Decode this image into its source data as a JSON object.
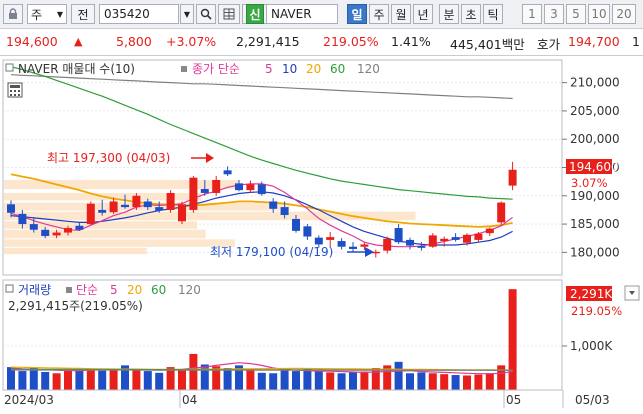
{
  "toolbar": {
    "lock_icon": "lock-icon",
    "period_label": "주",
    "jeon_label": "전",
    "code_value": "035420",
    "search_icon": "search-icon",
    "grid_icon": "grid-icon",
    "sound_icon": "speaker-icon",
    "new_badge": "신",
    "stock_name": "NAVER",
    "period_tabs": [
      "일",
      "주",
      "월",
      "년",
      "분",
      "초",
      "틱"
    ],
    "selected_period": "일",
    "interval_buttons": [
      "1",
      "3",
      "5",
      "10",
      "20"
    ]
  },
  "quote": {
    "price": "194,600",
    "change_arrow": "▲",
    "change": "5,800",
    "change_pct": "+3.07%",
    "volume": "2,291,415",
    "volume_ratio": "219.05%",
    "turnover": "1.41%",
    "amount": "445,401백만",
    "ask_label": "호가",
    "ask_price": "194,700",
    "tail": "1"
  },
  "price_panel": {
    "title": "NAVER 매물대 수(10)",
    "ma_label": "종가 단순",
    "ma_periods": [
      "5",
      "10",
      "20",
      "60",
      "120"
    ],
    "max_annotation": "최고 197,300 (04/03)",
    "min_annotation": "최저 179,100 (04/19)",
    "current_price_tag": "194,600",
    "current_pct_tag": "3.07%",
    "y_ticks": [
      "210,000",
      "205,000",
      "200,000",
      "195,000",
      "190,000",
      "185,000",
      "180,000"
    ]
  },
  "volume_panel": {
    "title": "거래량",
    "ma_label": "단순",
    "ma_periods": [
      "5",
      "20",
      "60",
      "120"
    ],
    "info": "2,291,415주(219.05%)",
    "current_tag": "2,291K",
    "current_pct_tag": "219.05%",
    "y_ticks": [
      "1,000K"
    ]
  },
  "x_axis": [
    "2024/03",
    "04",
    "05",
    "05/03"
  ],
  "colors": {
    "up": "#e8201c",
    "down": "#1f4fc7",
    "ma5": "#e0389a",
    "ma10": "#1f3fbf",
    "ma20": "#f0a800",
    "ma60": "#2e9e3c",
    "ma120": "#808080"
  },
  "chart_data": [
    {
      "type": "candlestick",
      "title": "NAVER 매물대 수(10)",
      "ylim": [
        176000,
        214000
      ],
      "volume_profile_bins": 10,
      "candles": [
        {
          "o": 188500,
          "h": 189200,
          "l": 186200,
          "c": 187000
        },
        {
          "o": 186800,
          "h": 187500,
          "l": 184200,
          "c": 185000
        },
        {
          "o": 185000,
          "h": 186000,
          "l": 183500,
          "c": 184000
        },
        {
          "o": 184000,
          "h": 184500,
          "l": 182500,
          "c": 182900
        },
        {
          "o": 183000,
          "h": 184000,
          "l": 182500,
          "c": 183500
        },
        {
          "o": 183500,
          "h": 184700,
          "l": 183000,
          "c": 184300
        },
        {
          "o": 184700,
          "h": 185200,
          "l": 183800,
          "c": 184000
        },
        {
          "o": 185000,
          "h": 189000,
          "l": 184800,
          "c": 188600
        },
        {
          "o": 187500,
          "h": 189300,
          "l": 186500,
          "c": 187000
        },
        {
          "o": 187100,
          "h": 189700,
          "l": 186800,
          "c": 189000
        },
        {
          "o": 188400,
          "h": 190200,
          "l": 187700,
          "c": 188000
        },
        {
          "o": 188000,
          "h": 190500,
          "l": 187500,
          "c": 190000
        },
        {
          "o": 189000,
          "h": 189500,
          "l": 187500,
          "c": 188000
        },
        {
          "o": 188000,
          "h": 189000,
          "l": 187000,
          "c": 187400
        },
        {
          "o": 187500,
          "h": 191000,
          "l": 187000,
          "c": 190500
        },
        {
          "o": 185500,
          "h": 189000,
          "l": 185000,
          "c": 188500
        },
        {
          "o": 187500,
          "h": 193500,
          "l": 187000,
          "c": 193200
        },
        {
          "o": 191200,
          "h": 192800,
          "l": 190000,
          "c": 190500
        },
        {
          "o": 190500,
          "h": 193500,
          "l": 190000,
          "c": 192800
        },
        {
          "o": 194500,
          "h": 195200,
          "l": 193500,
          "c": 193800
        },
        {
          "o": 192200,
          "h": 192800,
          "l": 190800,
          "c": 191000
        },
        {
          "o": 191000,
          "h": 192700,
          "l": 190500,
          "c": 192000
        },
        {
          "o": 192000,
          "h": 192500,
          "l": 190000,
          "c": 190300
        },
        {
          "o": 189000,
          "h": 189600,
          "l": 187000,
          "c": 187700
        },
        {
          "o": 188000,
          "h": 189000,
          "l": 186000,
          "c": 186600
        },
        {
          "o": 185900,
          "h": 186600,
          "l": 183500,
          "c": 183800
        },
        {
          "o": 184600,
          "h": 185000,
          "l": 182200,
          "c": 182800
        },
        {
          "o": 182600,
          "h": 183000,
          "l": 180800,
          "c": 181400
        },
        {
          "o": 182200,
          "h": 183600,
          "l": 181000,
          "c": 182700
        },
        {
          "o": 182000,
          "h": 182500,
          "l": 180500,
          "c": 181000
        },
        {
          "o": 181000,
          "h": 181800,
          "l": 180000,
          "c": 180600
        },
        {
          "o": 181000,
          "h": 181700,
          "l": 180400,
          "c": 181400
        },
        {
          "o": 179900,
          "h": 180500,
          "l": 179100,
          "c": 180100
        },
        {
          "o": 180300,
          "h": 182800,
          "l": 179800,
          "c": 182400
        },
        {
          "o": 184300,
          "h": 185000,
          "l": 181500,
          "c": 181800
        },
        {
          "o": 182200,
          "h": 182600,
          "l": 180500,
          "c": 181200
        },
        {
          "o": 181100,
          "h": 181800,
          "l": 180300,
          "c": 180800
        },
        {
          "o": 181000,
          "h": 183400,
          "l": 180800,
          "c": 183000
        },
        {
          "o": 182000,
          "h": 182800,
          "l": 181000,
          "c": 182400
        },
        {
          "o": 182700,
          "h": 183400,
          "l": 181900,
          "c": 182200
        },
        {
          "o": 181700,
          "h": 183400,
          "l": 181200,
          "c": 183100
        },
        {
          "o": 182200,
          "h": 183600,
          "l": 181800,
          "c": 183300
        },
        {
          "o": 183400,
          "h": 184400,
          "l": 182900,
          "c": 184200
        },
        {
          "o": 185300,
          "h": 189000,
          "l": 184900,
          "c": 188800
        },
        {
          "o": 191800,
          "h": 196000,
          "l": 191000,
          "c": 194600
        }
      ],
      "ma5": [
        186900,
        186300,
        185600,
        185000,
        184500,
        184000,
        183900,
        184800,
        185600,
        186500,
        187100,
        188000,
        188400,
        188300,
        188400,
        188600,
        189500,
        190300,
        190800,
        191500,
        191900,
        192100,
        192100,
        191700,
        190600,
        189200,
        187700,
        186000,
        184800,
        183800,
        182900,
        181800,
        181300,
        181100,
        181000,
        181000,
        181100,
        181500,
        181900,
        182400,
        182800,
        183300,
        183900,
        184700,
        186200
      ],
      "ma10": [
        186500,
        186300,
        186100,
        185900,
        185700,
        185500,
        185300,
        185300,
        185500,
        185800,
        186100,
        186500,
        187000,
        187400,
        187700,
        188000,
        188500,
        189000,
        189600,
        190000,
        190400,
        190600,
        190700,
        190500,
        190000,
        189300,
        188400,
        187500,
        186500,
        185500,
        184500,
        183700,
        183100,
        182500,
        182000,
        181700,
        181400,
        181300,
        181300,
        181300,
        181500,
        181800,
        182100,
        182700,
        183700
      ],
      "ma20": [
        193800,
        193400,
        193000,
        192500,
        192000,
        191500,
        191000,
        190400,
        189900,
        189500,
        189200,
        188900,
        188700,
        188500,
        188400,
        188300,
        188300,
        188400,
        188600,
        188800,
        189000,
        189000,
        188900,
        188800,
        188600,
        188300,
        188000,
        187600,
        187200,
        186800,
        186400,
        186100,
        185800,
        185500,
        185300,
        185100,
        185000,
        184900,
        184800,
        184700,
        184600,
        184500,
        184600,
        184800,
        185200
      ],
      "ma60": [
        212800,
        212300,
        211700,
        211100,
        210400,
        209700,
        209000,
        208300,
        207600,
        206800,
        206000,
        205200,
        204400,
        203500,
        202600,
        201800,
        201000,
        200200,
        199400,
        198600,
        197800,
        197000,
        196300,
        195700,
        195100,
        194500,
        194000,
        193500,
        193000,
        192600,
        192300,
        192000,
        191700,
        191400,
        191100,
        190900,
        190700,
        190500,
        190300,
        190100,
        189900,
        189800,
        189600,
        189500,
        189400
      ],
      "ma120": [
        211400,
        211300,
        211200,
        211100,
        211000,
        210900,
        210800,
        210700,
        210600,
        210500,
        210400,
        210300,
        210200,
        210100,
        210000,
        209900,
        209800,
        209800,
        209700,
        209600,
        209500,
        209400,
        209300,
        209200,
        209100,
        209000,
        208900,
        208800,
        208700,
        208600,
        208500,
        208400,
        208300,
        208200,
        208100,
        208000,
        207900,
        207800,
        207700,
        207600,
        207500,
        207500,
        207400,
        207300,
        207200
      ],
      "volume_profile": [
        {
          "from": 191000,
          "to": 192800,
          "volume": 0.56
        },
        {
          "from": 189000,
          "to": 190500,
          "volume": 0.47
        },
        {
          "from": 187200,
          "to": 188800,
          "volume": 0.68
        },
        {
          "from": 185500,
          "to": 187200,
          "volume": 0.98
        },
        {
          "from": 184000,
          "to": 185500,
          "volume": 0.46
        },
        {
          "from": 182300,
          "to": 184000,
          "volume": 0.48
        },
        {
          "from": 180800,
          "to": 182300,
          "volume": 0.55
        },
        {
          "from": 179500,
          "to": 180800,
          "volume": 0.34
        }
      ]
    },
    {
      "type": "bar",
      "title": "거래량",
      "series": [
        {
          "name": "거래량",
          "values": [
            520,
            430,
            500,
            410,
            380,
            480,
            470,
            460,
            440,
            450,
            560,
            470,
            430,
            390,
            520,
            460,
            820,
            580,
            540,
            500,
            560,
            480,
            390,
            380,
            480,
            430,
            500,
            420,
            400,
            380,
            400,
            420,
            500,
            560,
            640,
            380,
            400,
            380,
            360,
            340,
            330,
            350,
            380,
            560,
            2291
          ]
        },
        {
          "name": "5",
          "values": [
            500,
            480,
            470,
            460,
            450,
            440,
            440,
            450,
            460,
            470,
            480,
            470,
            460,
            450,
            460,
            470,
            500,
            520,
            560,
            590,
            620,
            600,
            560,
            500,
            470,
            450,
            440,
            430,
            430,
            420,
            410,
            400,
            410,
            420,
            430,
            440,
            420,
            410,
            400,
            390,
            380,
            370,
            370,
            380,
            420
          ]
        },
        {
          "name": "20",
          "values": [
            520,
            515,
            510,
            505,
            500,
            495,
            490,
            485,
            480,
            478,
            476,
            474,
            472,
            470,
            470,
            470,
            472,
            474,
            476,
            478,
            480,
            482,
            484,
            486,
            488,
            490,
            488,
            486,
            484,
            482,
            480,
            478,
            476,
            474,
            472,
            470,
            468,
            466,
            464,
            462,
            460,
            458,
            456,
            454,
            452
          ]
        },
        {
          "name": "60",
          "values": [
            470,
            470,
            469,
            469,
            468,
            468,
            467,
            467,
            466,
            466,
            465,
            465,
            464,
            464,
            463,
            463,
            462,
            462,
            461,
            461,
            460,
            460,
            459,
            459,
            458,
            458,
            457,
            457,
            456,
            456,
            455,
            455,
            454,
            454,
            453,
            453,
            452,
            452,
            451,
            451,
            450,
            450,
            449,
            449,
            448
          ]
        },
        {
          "name": "120",
          "values": [
            455,
            455,
            455,
            455,
            455,
            455,
            454,
            454,
            454,
            454,
            454,
            454,
            453,
            453,
            453,
            453,
            453,
            453,
            452,
            452,
            452,
            452,
            452,
            452,
            451,
            451,
            451,
            451,
            451,
            451,
            450,
            450,
            450,
            450,
            450,
            450,
            449,
            449,
            449,
            449,
            449,
            449,
            448,
            448,
            448
          ]
        }
      ],
      "unit": "K",
      "ylim": [
        0,
        2500
      ]
    }
  ]
}
